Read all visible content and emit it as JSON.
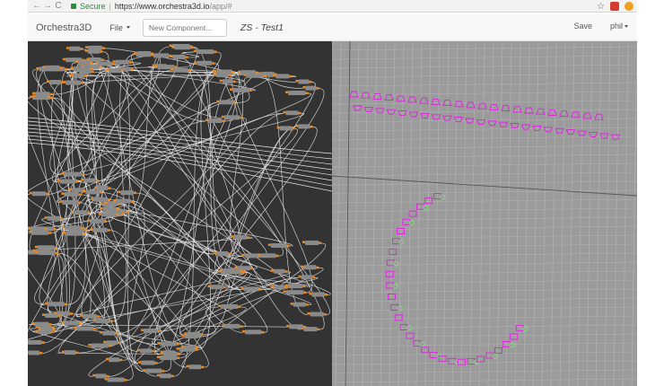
{
  "browser": {
    "secure_label": "Secure",
    "url_host": "https://www.orchestra3d.io",
    "url_path": "/app/#",
    "icons": [
      "back-icon",
      "forward-icon",
      "reload-icon",
      "lock-icon",
      "star-icon",
      "extension-icon"
    ]
  },
  "app_nav": {
    "brand": "Orchestra3D",
    "file_label": "File",
    "component_placeholder": "New Component...",
    "doc_title": "ZS - Test1",
    "save_label": "Save",
    "user_label": "phil"
  },
  "graph": {
    "background": "#333333",
    "node_color": "#8a8a8a",
    "port_color": "#f08a1c",
    "wire_color": "#e6e6e6"
  },
  "viewport": {
    "background": "#9b9b9b",
    "grid_color": "#b5b5b5",
    "preview_color": "#e020e0",
    "selection_color": "#7fe07f"
  }
}
